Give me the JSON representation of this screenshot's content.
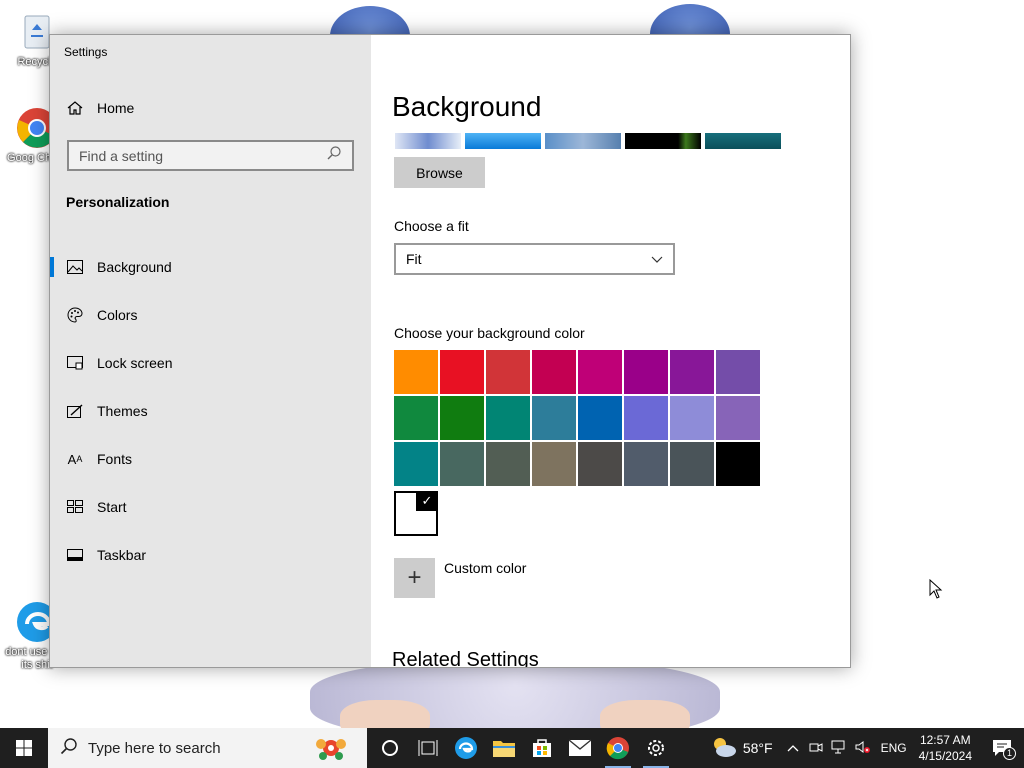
{
  "desktop": {
    "icons": [
      {
        "label": "Recycle"
      },
      {
        "label": "Goog Chron"
      },
      {
        "label": "dont use one its shit"
      }
    ]
  },
  "window": {
    "title": "Settings",
    "minimize_icon": "minimize-icon",
    "maximize_icon": "maximize-icon",
    "close_icon": "close-icon"
  },
  "sidebar": {
    "home_label": "Home",
    "search_placeholder": "Find a setting",
    "section_title": "Personalization",
    "items": [
      {
        "label": "Background",
        "icon": "picture-icon",
        "active": true
      },
      {
        "label": "Colors",
        "icon": "palette-icon",
        "active": false
      },
      {
        "label": "Lock screen",
        "icon": "lock-screen-icon",
        "active": false
      },
      {
        "label": "Themes",
        "icon": "themes-icon",
        "active": false
      },
      {
        "label": "Fonts",
        "icon": "fonts-icon",
        "active": false
      },
      {
        "label": "Start",
        "icon": "start-icon",
        "active": false
      },
      {
        "label": "Taskbar",
        "icon": "taskbar-icon",
        "active": false
      }
    ]
  },
  "main": {
    "page_title": "Background",
    "browse_label": "Browse",
    "fit_label": "Choose a fit",
    "fit_value": "Fit",
    "color_label": "Choose your background color",
    "colors": [
      "#ff8c00",
      "#e81123",
      "#d13438",
      "#c30052",
      "#bf0077",
      "#9a0089",
      "#881798",
      "#744da9",
      "#10893e",
      "#107c10",
      "#018574",
      "#2d7d9a",
      "#0063b1",
      "#6b69d6",
      "#8e8cd8",
      "#8764b8",
      "#038387",
      "#486860",
      "#525e54",
      "#7e735f",
      "#4c4a48",
      "#515c6b",
      "#4a5459",
      "#000000"
    ],
    "selected_color": "#ffffff",
    "custom_color_label": "Custom color",
    "related_title": "Related Settings"
  },
  "taskbar": {
    "search_placeholder": "Type here to search",
    "weather_temp": "58°F",
    "language": "ENG",
    "time": "12:57 AM",
    "date": "4/15/2024",
    "notification_count": "1"
  }
}
